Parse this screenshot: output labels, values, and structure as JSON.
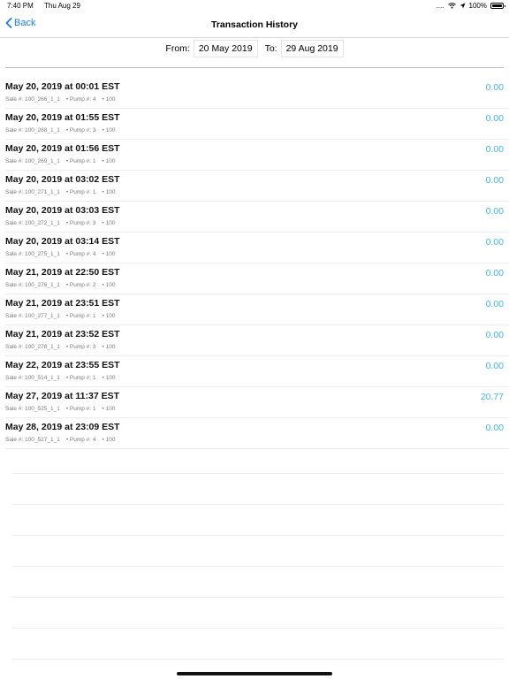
{
  "status_bar": {
    "time": "7:40 PM",
    "date": "Thu Aug 29",
    "signal": "....",
    "battery_percent": "100%"
  },
  "nav": {
    "back_label": "Back",
    "title": "Transaction History"
  },
  "filter": {
    "from_label": "From:",
    "from_value": "20 May 2019",
    "to_label": "To:",
    "to_value": "29 Aug 2019"
  },
  "transactions": [
    {
      "date": "May 20, 2019 at 00:01 EST",
      "sale": "Sale #: 100_266_1_1",
      "pump": "• Pump #: 4",
      "extra": "• 100",
      "amount": "0.00"
    },
    {
      "date": "May 20, 2019 at 01:55 EST",
      "sale": "Sale #: 100_268_1_1",
      "pump": "• Pump #: 3",
      "extra": "• 100",
      "amount": "0.00"
    },
    {
      "date": "May 20, 2019 at 01:56 EST",
      "sale": "Sale #: 100_269_1_1",
      "pump": "• Pump #: 1",
      "extra": "• 100",
      "amount": "0.00"
    },
    {
      "date": "May 20, 2019 at 03:02 EST",
      "sale": "Sale #: 100_271_1_1",
      "pump": "• Pump #: 1",
      "extra": "• 100",
      "amount": "0.00"
    },
    {
      "date": "May 20, 2019 at 03:03 EST",
      "sale": "Sale #: 100_272_1_1",
      "pump": "• Pump #: 3",
      "extra": "• 100",
      "amount": "0.00"
    },
    {
      "date": "May 20, 2019 at 03:14 EST",
      "sale": "Sale #: 100_275_1_1",
      "pump": "• Pump #: 4",
      "extra": "• 100",
      "amount": "0.00"
    },
    {
      "date": "May 21, 2019 at 22:50 EST",
      "sale": "Sale #: 100_276_1_1",
      "pump": "• Pump #: 2",
      "extra": "• 100",
      "amount": "0.00"
    },
    {
      "date": "May 21, 2019 at 23:51 EST",
      "sale": "Sale #: 100_277_1_1",
      "pump": "• Pump #: 1",
      "extra": "• 100",
      "amount": "0.00"
    },
    {
      "date": "May 21, 2019 at 23:52 EST",
      "sale": "Sale #: 100_278_1_1",
      "pump": "• Pump #: 3",
      "extra": "• 100",
      "amount": "0.00"
    },
    {
      "date": "May 22, 2019 at 23:55 EST",
      "sale": "Sale #: 100_514_1_1",
      "pump": "• Pump #: 1",
      "extra": "• 100",
      "amount": "0.00"
    },
    {
      "date": "May 27, 2019 at 11:37 EST",
      "sale": "Sale #: 100_525_1_1",
      "pump": "• Pump #: 1",
      "extra": "• 100",
      "amount": "20.77"
    },
    {
      "date": "May 28, 2019 at 23:09 EST",
      "sale": "Sale #: 100_527_1_1",
      "pump": "• Pump #: 4",
      "extra": "• 100",
      "amount": "0.00"
    }
  ],
  "colors": {
    "accent": "#1a7cf5",
    "amount": "#3fb7e6"
  }
}
